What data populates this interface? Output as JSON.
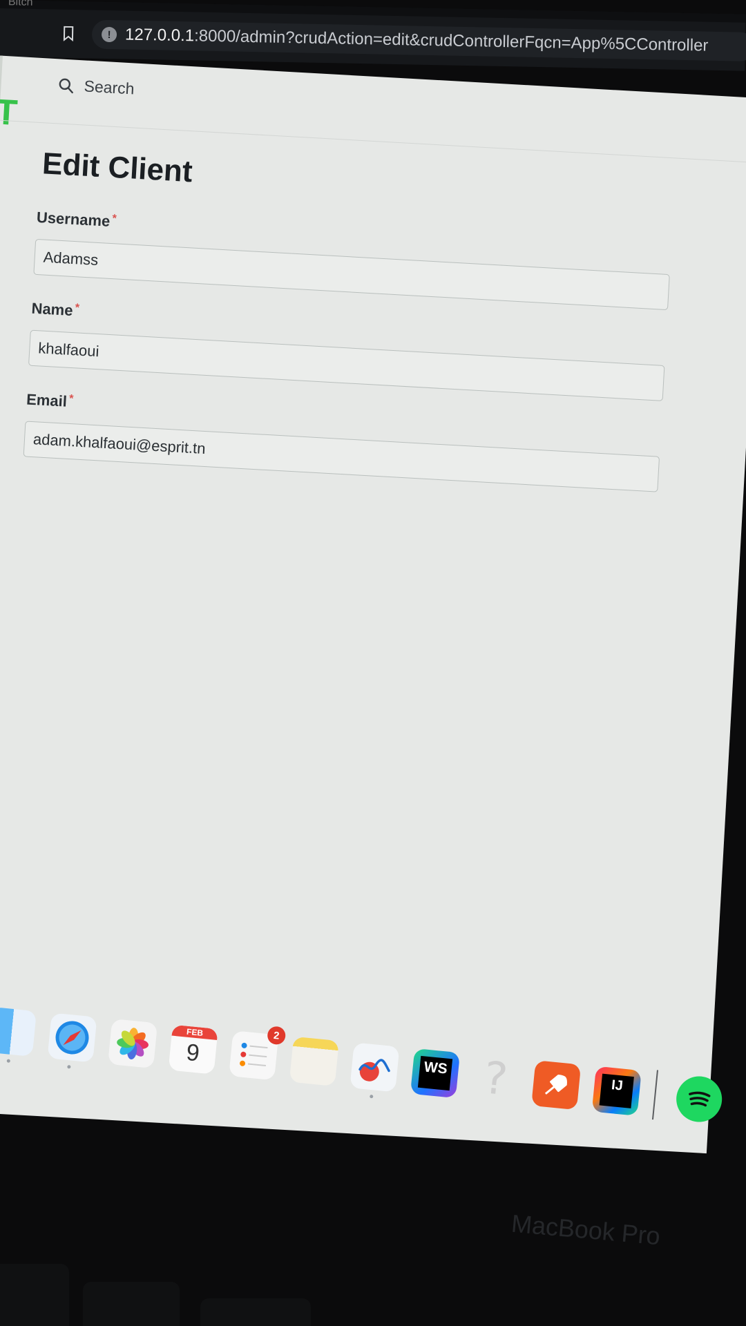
{
  "browser": {
    "tab_title": "Bitch",
    "url_host": "127.0.0.1",
    "url_rest": ":8000/admin?crudAction=edit&crudControllerFqcn=App%5CController"
  },
  "sidebar": {
    "brand_letter": "T",
    "brand_color": "#37c24a"
  },
  "topbar": {
    "search_label": "Search"
  },
  "page": {
    "title": "Edit Client"
  },
  "form": {
    "required_marker": "*",
    "fields": [
      {
        "label": "Username",
        "value": "Adamss",
        "required": true
      },
      {
        "label": "Name",
        "value": "khalfaoui",
        "required": true
      },
      {
        "label": "Email",
        "value": "adam.khalfaoui@esprit.tn",
        "required": true
      }
    ]
  },
  "dock": {
    "calendar": {
      "month": "FEB",
      "day": "9"
    },
    "reminders_badge": "2",
    "webstorm_label": "WS",
    "intellij_label": "IJ",
    "help_glyph": "?",
    "apps": [
      "finder-icon",
      "safari-icon",
      "photos-icon",
      "calendar-icon",
      "reminders-icon",
      "notes-icon",
      "freeform-icon",
      "webstorm-icon",
      "help-icon",
      "postman-icon",
      "intellij-icon",
      "spotify-icon"
    ]
  },
  "hardware": {
    "bezel_label": "MacBook Pro"
  }
}
